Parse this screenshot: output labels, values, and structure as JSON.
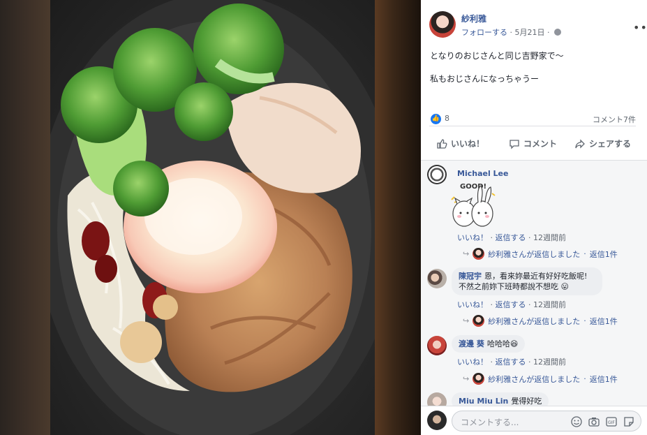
{
  "post": {
    "author": "紗利雅",
    "follow_label": "フォローする",
    "separator": " · ",
    "date": "5月21日",
    "separator2": " · ",
    "text_line1": "となりのおじさんと同じ吉野家で～",
    "text_line2": "私もおじさんになっちゃうー",
    "more_icon": "•••"
  },
  "stats": {
    "likes": "8",
    "comments": "コメント7件"
  },
  "actions": {
    "like": "いいね！",
    "comment": "コメント",
    "share": "シェアする"
  },
  "comments": [
    {
      "name": "Michael Lee",
      "sticker_text": "GOOD!",
      "like": "いいね！",
      "reply": "返信する",
      "time": "12週間前",
      "reply_summary": "紗利雅さんが返信しました",
      "reply_count": "返信1件"
    },
    {
      "name": "陳冠宇",
      "text1": "恩，看來妳最近有好好吃飯呢!",
      "text2": "不然之前妳下班時都說不想吃",
      "emoji": "😛",
      "like": "いいね！",
      "reply": "返信する",
      "time": "12週間前",
      "reply_summary": "紗利雅さんが返信しました",
      "reply_count": "返信1件"
    },
    {
      "name": "渡邊 葵",
      "text1": "哈哈哈",
      "emoji": "😆",
      "like": "いいね！",
      "reply": "返信する",
      "time": "12週間前",
      "reply_summary": "紗利雅さんが返信しました",
      "reply_count": "返信1件"
    },
    {
      "name": "Miu Miu Lin",
      "text1": "覺得好吃"
    }
  ],
  "compose": {
    "placeholder": "コメントする..."
  },
  "separators": {
    "dot": " · ",
    "arrow": "↪"
  },
  "colors": {
    "link": "#385898",
    "like_blue": "#1877f2",
    "panel_bg": "#ffffff",
    "comments_bg": "#f5f6f7"
  }
}
